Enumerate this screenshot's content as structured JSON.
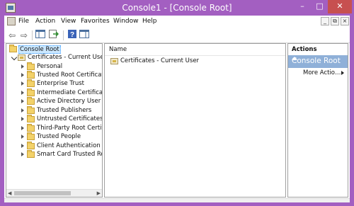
{
  "window": {
    "title": "Console1 - [Console Root]",
    "minimize": "–",
    "maximize": "□",
    "close": "✕"
  },
  "menu": {
    "items": [
      "File",
      "Action",
      "View",
      "Favorites",
      "Window",
      "Help"
    ],
    "mdi": [
      "_",
      "⧉",
      "×"
    ]
  },
  "toolbar": {
    "buttons": [
      "back-icon",
      "forward-icon",
      "show-hide-console-tree-icon",
      "export-list-icon",
      "help-icon",
      "show-hide-action-pane-icon"
    ]
  },
  "tree": {
    "root": "Console Root",
    "node": "Certificates - Current User",
    "children": [
      "Personal",
      "Trusted Root Certification Authorities",
      "Enterprise Trust",
      "Intermediate Certification Authorities",
      "Active Directory User Object",
      "Trusted Publishers",
      "Untrusted Certificates",
      "Third-Party Root Certification Authorities",
      "Trusted People",
      "Client Authentication Issuers",
      "Smart Card Trusted Roots"
    ]
  },
  "list": {
    "column_name": "Name",
    "items": [
      "Certificates - Current User"
    ]
  },
  "actions": {
    "header": "Actions",
    "section": "Console Root",
    "more": "More Actio…"
  },
  "colors": {
    "accent": "#a35fc1",
    "close": "#c75050",
    "action_section": "#8fb0d8",
    "selection": "#cce8ff"
  }
}
